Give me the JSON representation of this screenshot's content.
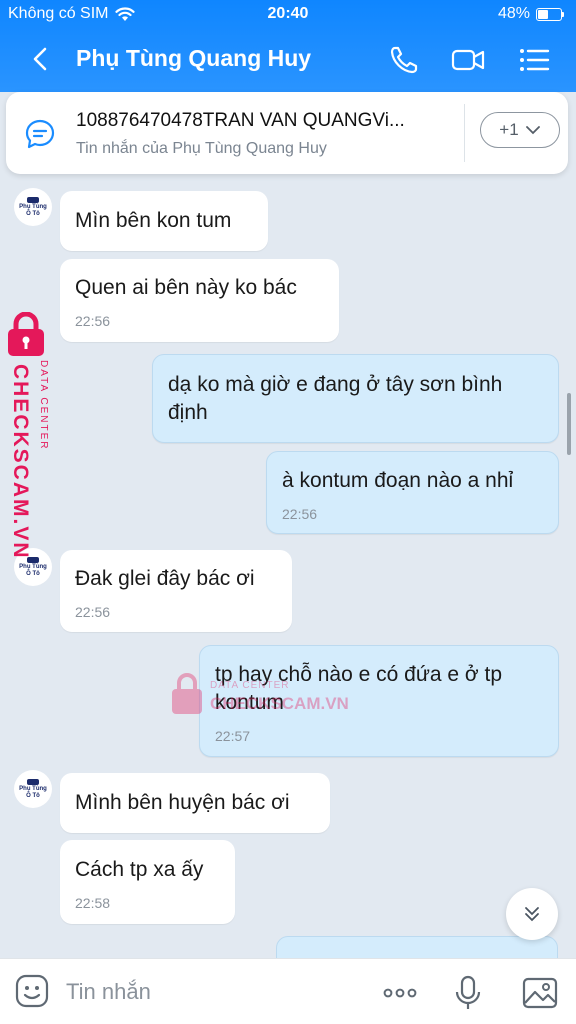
{
  "status_bar": {
    "carrier": "Không có SIM",
    "time": "20:40",
    "battery": "48%",
    "battery_level": 0.48
  },
  "header": {
    "title": "Phụ Tùng Quang Huy"
  },
  "pinned": {
    "title": "108876470478TRAN VAN QUANGVi...",
    "subtitle": "Tin nhắn của Phụ Tùng Quang Huy",
    "more": "+1"
  },
  "avatar": {
    "lines": [
      "Phụ Tùng",
      "Ô Tô"
    ]
  },
  "messages": [
    {
      "side": "received",
      "text": "Mìn bên kon tum",
      "time": ""
    },
    {
      "side": "received",
      "text": "Quen ai bên này ko bác",
      "time": "22:56"
    },
    {
      "side": "sent",
      "text": "dạ ko mà giờ e đang ở tây sơn bình định",
      "time": ""
    },
    {
      "side": "sent",
      "text": "à kontum đoạn nào a nhỉ",
      "time": "22:56"
    },
    {
      "side": "received",
      "text": "Đak glei đây bác ơi",
      "time": "22:56"
    },
    {
      "side": "sent",
      "text": "tp hay chỗ nào e có đứa e ở tp kontum",
      "time": "22:57"
    },
    {
      "side": "received",
      "text": "Mình bên huyện bác ơi",
      "time": ""
    },
    {
      "side": "received",
      "text": "Cách tp xa ấy",
      "time": "22:58"
    }
  ],
  "watermark": {
    "brand": "CHECKSCAM.VN",
    "tag": "DATA CENTER"
  },
  "input": {
    "placeholder": "Tin nhắn"
  },
  "colors": {
    "header": "#1a8cff",
    "sent_bubble": "#d4ecfc",
    "received_bubble": "#ffffff",
    "watermark": "#e4185a"
  }
}
